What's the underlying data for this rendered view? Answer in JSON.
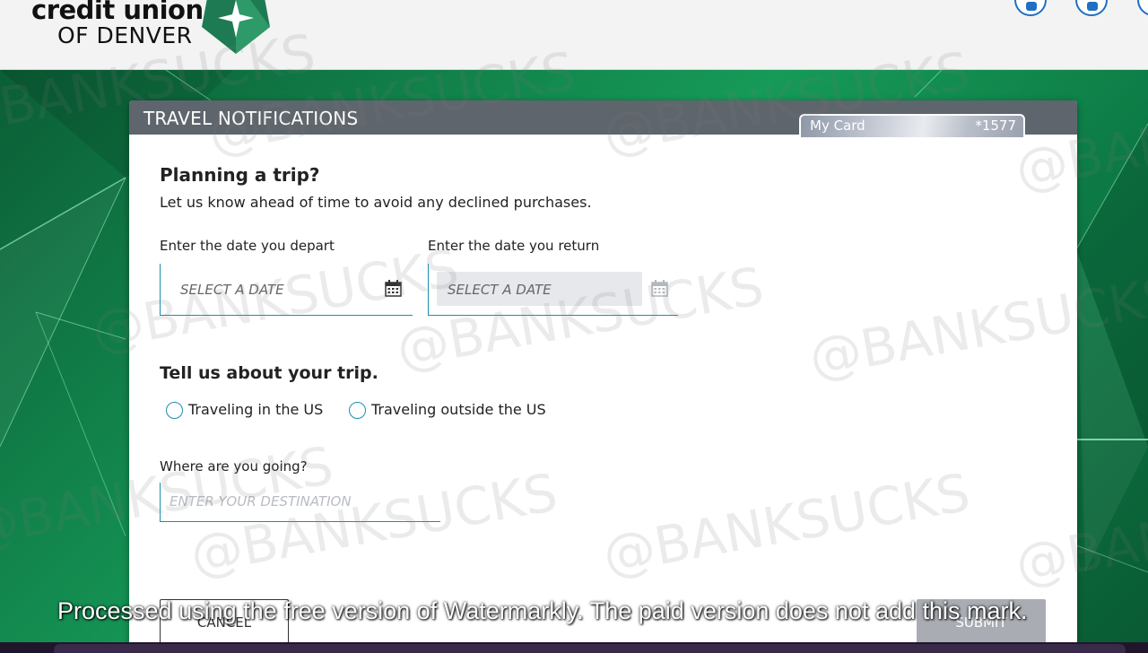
{
  "header": {
    "logo_line1": "credit union",
    "logo_line2": "OF DENVER",
    "icons": [
      "user-icon",
      "wallet-icon",
      "lock-icon"
    ]
  },
  "panel": {
    "title": "TRAVEL NOTIFICATIONS",
    "card": {
      "name": "My Card",
      "number": "*1577"
    }
  },
  "form": {
    "heading": "Planning a trip?",
    "lead": "Let us know ahead of time to avoid any declined purchases.",
    "depart_label": "Enter the date you depart",
    "return_label": "Enter the date you return",
    "depart_placeholder": "SELECT A DATE",
    "return_placeholder": "SELECT A DATE",
    "trip_heading": "Tell us about your trip.",
    "radio_us": "Traveling in the US",
    "radio_outside": "Traveling outside the US",
    "destination_label": "Where are you going?",
    "destination_placeholder": "ENTER YOUR DESTINATION",
    "cancel_label": "CANCEL",
    "submit_label": "SUBMIT"
  },
  "watermark": {
    "text": "@BANKSUCKS",
    "banner": "Processed using the free version of Watermarkly. The paid version does not add this mark."
  },
  "colors": {
    "brand_green": "#0f6b3f",
    "header_bar": "#5f656c",
    "field_accent": "#1a8fb0",
    "submit_disabled": "#a9adb3"
  }
}
